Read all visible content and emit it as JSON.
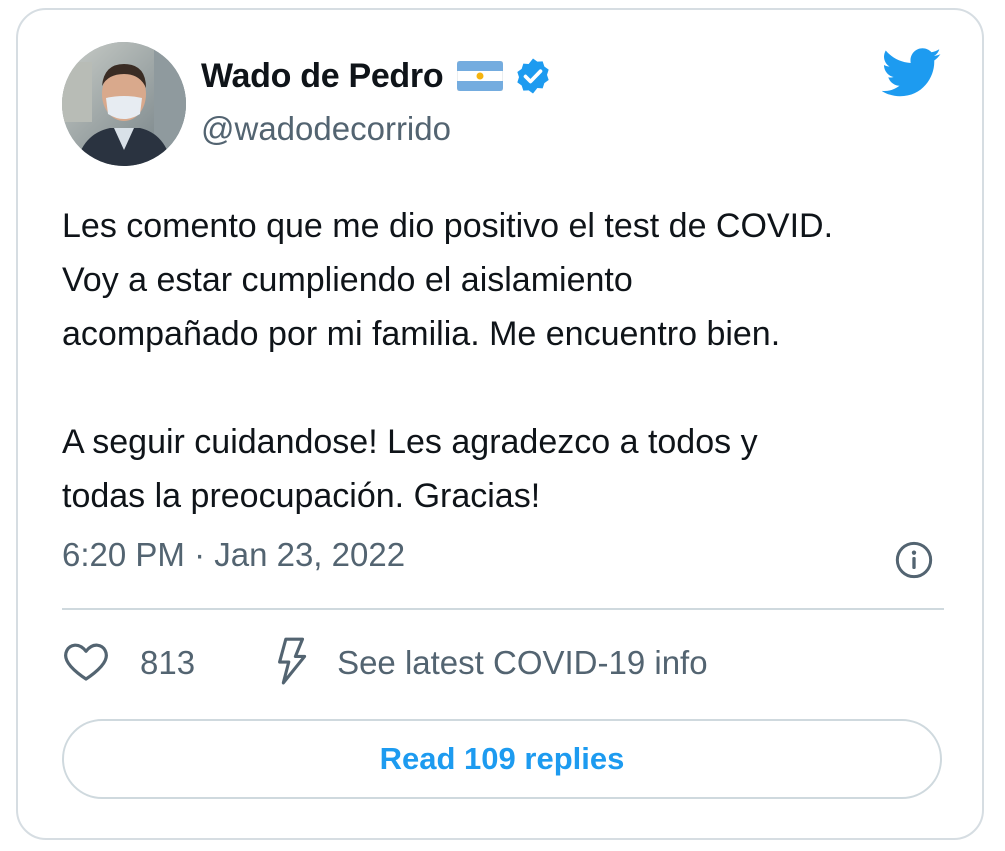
{
  "author": {
    "name": "Wado de Pedro",
    "handle": "@wadodecorrido"
  },
  "tweet": {
    "text": "Les comento que me dio positivo el test de COVID.\nVoy a estar cumpliendo el aislamiento\nacompañado por mi familia. Me encuentro bien.\n\nA seguir cuidandose! Les agradezco a todos y\ntodas la preocupación. Gracias!",
    "timestamp": "6:20 PM · Jan 23, 2022"
  },
  "actions": {
    "like_count": "813",
    "covid_info_label": "See latest COVID-19 info"
  },
  "replies_button": {
    "label": "Read 109 replies"
  },
  "icons": {
    "brand": "twitter-bird-icon",
    "verified": "verified-badge-icon",
    "flag": "argentina-flag-icon",
    "info": "info-icon",
    "like": "heart-icon",
    "covid": "lightning-icon"
  },
  "colors": {
    "accent": "#1d9bf0",
    "text": "#0f1419",
    "secondary_text": "#536471",
    "border": "#cfd9de",
    "card_border": "#d6dde2",
    "flag_blue": "#74acdf",
    "flag_sun": "#f6b40e"
  }
}
